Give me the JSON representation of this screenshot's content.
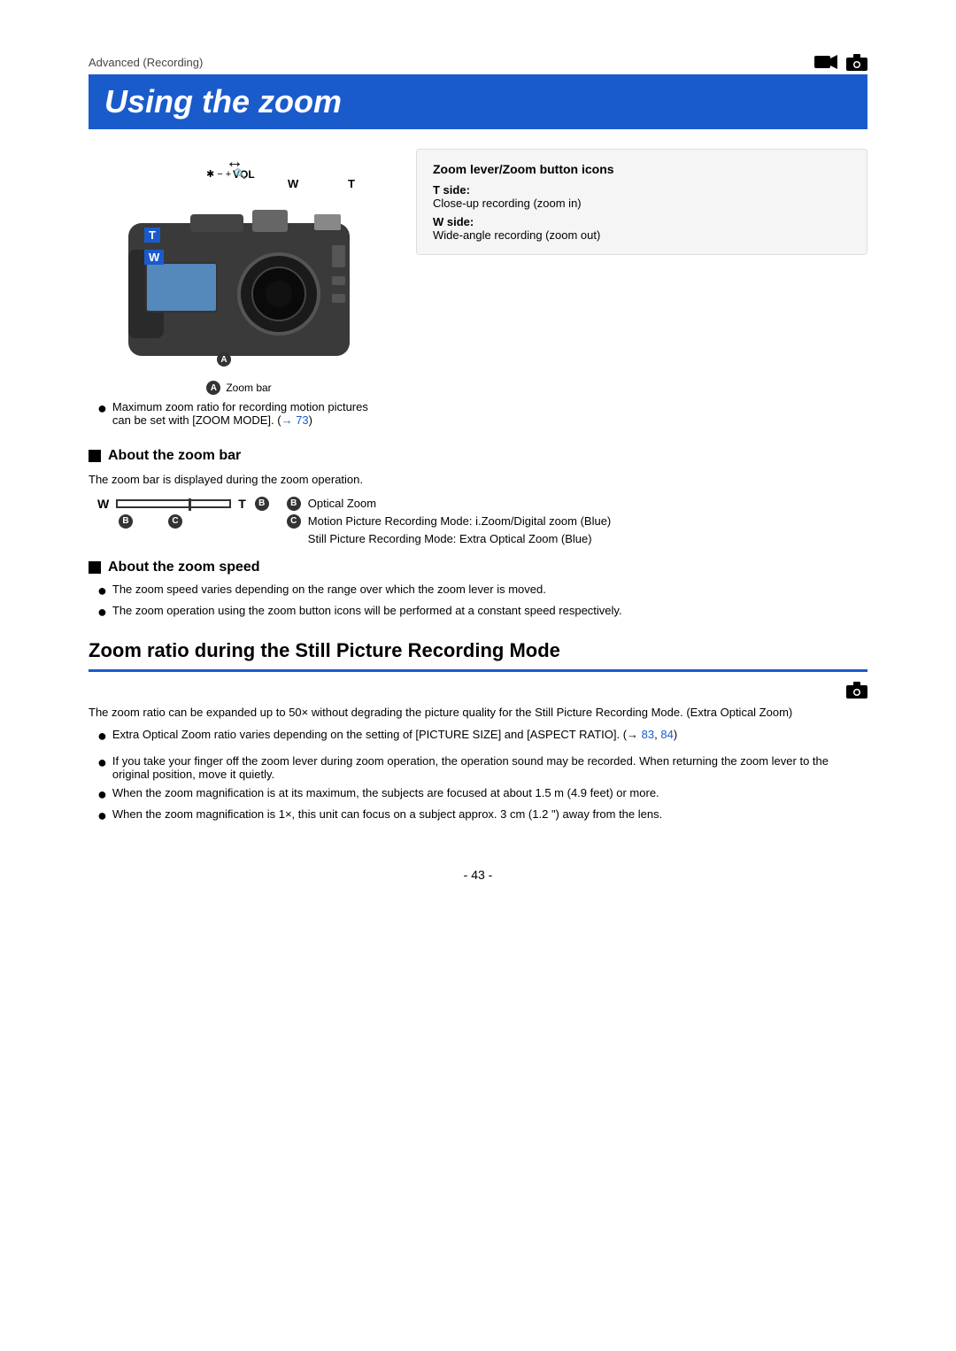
{
  "page": {
    "breadcrumb": "Advanced (Recording)",
    "breadcrumb_icons": [
      "video-icon",
      "camera-icon"
    ],
    "title": "Using the zoom",
    "section2_title": "Zoom ratio during the Still Picture Recording Mode",
    "page_number": "- 43 -"
  },
  "zoom_lever_box": {
    "title": "Zoom lever/Zoom button icons",
    "t_side_label": "T side:",
    "t_side_desc": "Close-up recording (zoom in)",
    "w_side_label": "W side:",
    "w_side_desc": "Wide-angle recording (zoom out)"
  },
  "camera_diagram": {
    "label_t": "T",
    "label_w": "W",
    "label_vol": "VOL",
    "label_w_top": "W",
    "label_t_top": "T",
    "label_a": "A",
    "zoom_bar_label": "Zoom bar"
  },
  "zoom_bar_note": "Maximum zoom ratio for recording motion pictures can be set with [ZOOM MODE]. (→ 73)",
  "about_zoom_bar": {
    "heading": "About the zoom bar",
    "desc": "The zoom bar is displayed during the zoom operation.",
    "label_w": "W",
    "label_t": "T",
    "label_b": "B",
    "label_c": "C",
    "optical_zoom": "Optical Zoom",
    "motion_zoom": "Motion Picture Recording Mode: i.Zoom/Digital zoom (Blue)",
    "still_zoom": "Still Picture Recording Mode: Extra Optical Zoom (Blue)"
  },
  "about_zoom_speed": {
    "heading": "About the zoom speed",
    "bullet1": "The zoom speed varies depending on the range over which the zoom lever is moved.",
    "bullet2": "The zoom operation using the zoom button icons will be performed at a constant speed respectively."
  },
  "section2": {
    "camera_icon": "camera",
    "desc1": "The zoom ratio can be expanded up to 50× without degrading the picture quality for the Still Picture Recording Mode. (Extra Optical Zoom)",
    "bullet1": "Extra Optical Zoom ratio varies depending on the setting of [PICTURE SIZE] and [ASPECT RATIO]. (→ 83, 84)",
    "bullet2": "If you take your finger off the zoom lever during zoom operation, the operation sound may be recorded. When returning the zoom lever to the original position, move it quietly.",
    "bullet3": "When the zoom magnification is at its maximum, the subjects are focused at about 1.5 m (4.9 feet) or more.",
    "bullet4": "When the zoom magnification is 1×, this unit can focus on a subject approx. 3 cm (1.2 \") away from the lens.",
    "ref_83": "83",
    "ref_84": "84"
  }
}
